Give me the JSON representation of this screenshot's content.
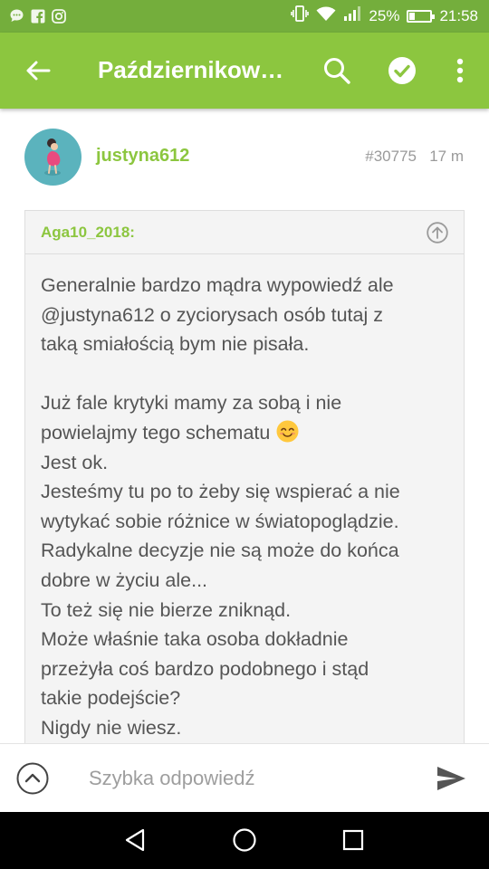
{
  "status_bar": {
    "battery_text": "25%",
    "battery_level": 0.25,
    "time": "21:58",
    "left_icons": [
      "chat-bubble-icon",
      "facebook-icon",
      "instagram-icon"
    ],
    "right_icons": [
      "vibrate-icon",
      "wifi-icon",
      "signal-icon",
      "battery-icon"
    ]
  },
  "app_bar": {
    "title": "Październikow…",
    "icons": [
      "back-arrow-icon",
      "search-icon",
      "check-circle-icon",
      "more-vert-icon"
    ]
  },
  "post": {
    "username": "justyna612",
    "post_number": "#30775",
    "time_ago": "17 m",
    "quote": {
      "author": "Aga10_2018:",
      "paragraphs": [
        [
          "Generalnie bardzo mądra wypowiedź ale",
          "@justyna612 o zyciorysach osób tutaj z",
          "taką smiałością bym nie pisała."
        ],
        [
          "Już fale krytyki mamy za sobą i nie",
          "powielajmy tego schematu",
          "Jest ok.",
          "Jesteśmy tu po to żeby się wspierać a nie",
          "wytykać sobie różnice w światopoglądzie.",
          "Radykalne decyzje nie są może do końca",
          "dobre w życiu ale...",
          "To też się nie bierze zniknąd.",
          "Może właśnie taka osoba dokładnie",
          "przeżyła coś bardzo podobnego i stąd",
          "takie podejście?",
          "Nigdy nie wiesz."
        ]
      ]
    }
  },
  "reply": {
    "placeholder": "Szybka odpowiedź"
  },
  "colors": {
    "status_bar": "#74ae3c",
    "app_bar": "#8cc63f",
    "accent": "#8cc63f",
    "text": "#555555",
    "muted": "#9a9a9a"
  }
}
